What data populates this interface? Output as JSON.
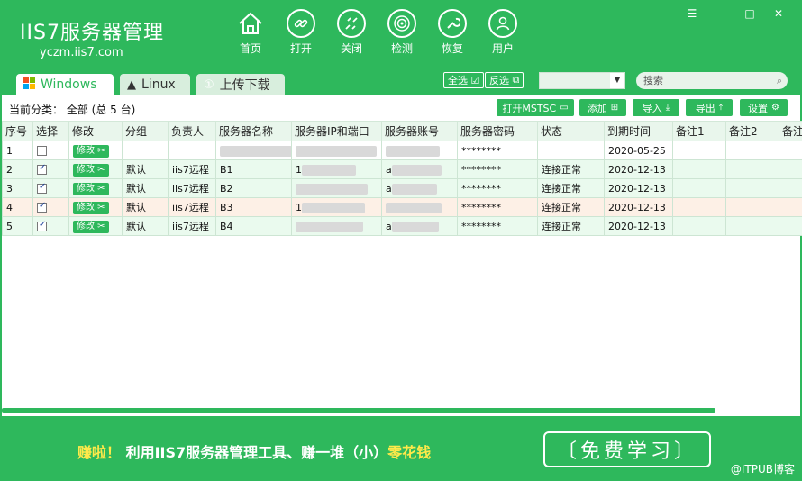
{
  "app": {
    "title": "IIS7服务器管理",
    "site": "yczm.iis7.com"
  },
  "nav": [
    {
      "label": "首页",
      "icon": "home-icon"
    },
    {
      "label": "打开",
      "icon": "link-icon"
    },
    {
      "label": "关闭",
      "icon": "unlink-icon"
    },
    {
      "label": "检测",
      "icon": "radar-icon"
    },
    {
      "label": "恢复",
      "icon": "wrench-icon"
    },
    {
      "label": "用户",
      "icon": "user-icon"
    }
  ],
  "window": {
    "menu": "☰",
    "min": "—",
    "max": "□",
    "close": "✕"
  },
  "tabs": [
    {
      "label": "Windows",
      "icon": "windows-icon"
    },
    {
      "label": "Linux",
      "icon": "linux-icon"
    },
    {
      "label": "上传下载",
      "icon": "upload-icon"
    }
  ],
  "selection": {
    "select_all": "全选",
    "invert": "反选"
  },
  "search": {
    "placeholder": "搜索"
  },
  "category": {
    "label": "当前分类：",
    "value": "全部 (总 5 台)"
  },
  "toolbar": {
    "mstsc": "打开MSTSC",
    "add": "添加",
    "import": "导入",
    "export": "导出",
    "settings": "设置"
  },
  "table": {
    "headers": [
      "序号",
      "选择",
      "修改",
      "分组",
      "负责人",
      "服务器名称",
      "服务器IP和端口",
      "服务器账号",
      "服务器密码",
      "状态",
      "到期时间",
      "备注1",
      "备注2",
      "备注"
    ],
    "edit_label": "修改",
    "rows": [
      {
        "no": "1",
        "checked": false,
        "group": "",
        "owner": "",
        "name": "",
        "ip": "",
        "account": "",
        "password": "********",
        "status": "",
        "expiry": "2020-05-25",
        "note1": "",
        "note2": "",
        "note3": ""
      },
      {
        "no": "2",
        "checked": true,
        "group": "默认",
        "owner": "iis7远程",
        "name": "B1",
        "ip": "1",
        "account": "a",
        "password": "********",
        "status": "连接正常",
        "expiry": "2020-12-13",
        "note1": "",
        "note2": "",
        "note3": ""
      },
      {
        "no": "3",
        "checked": true,
        "group": "默认",
        "owner": "iis7远程",
        "name": "B2",
        "ip": "",
        "account": "a",
        "password": "********",
        "status": "连接正常",
        "expiry": "2020-12-13",
        "note1": "",
        "note2": "",
        "note3": ""
      },
      {
        "no": "4",
        "checked": true,
        "group": "默认",
        "owner": "iis7远程",
        "name": "B3",
        "ip": "1",
        "account": "",
        "password": "********",
        "status": "连接正常",
        "expiry": "2020-12-13",
        "note1": "",
        "note2": "",
        "note3": ""
      },
      {
        "no": "5",
        "checked": true,
        "group": "默认",
        "owner": "iis7远程",
        "name": "B4",
        "ip": "",
        "account": "a",
        "password": "********",
        "status": "连接正常",
        "expiry": "2020-12-13",
        "note1": "",
        "note2": "",
        "note3": ""
      }
    ]
  },
  "footer": {
    "promo_1": "赚啦！",
    "promo_2": "利用IIS7服务器管理工具、赚一堆（小）",
    "promo_3": "零花钱",
    "learn": "〔免费学习〕",
    "watermark": "@ITPUB博客"
  },
  "colors": {
    "brand": "#2eb85c",
    "promo_yellow": "#ffe94a"
  }
}
